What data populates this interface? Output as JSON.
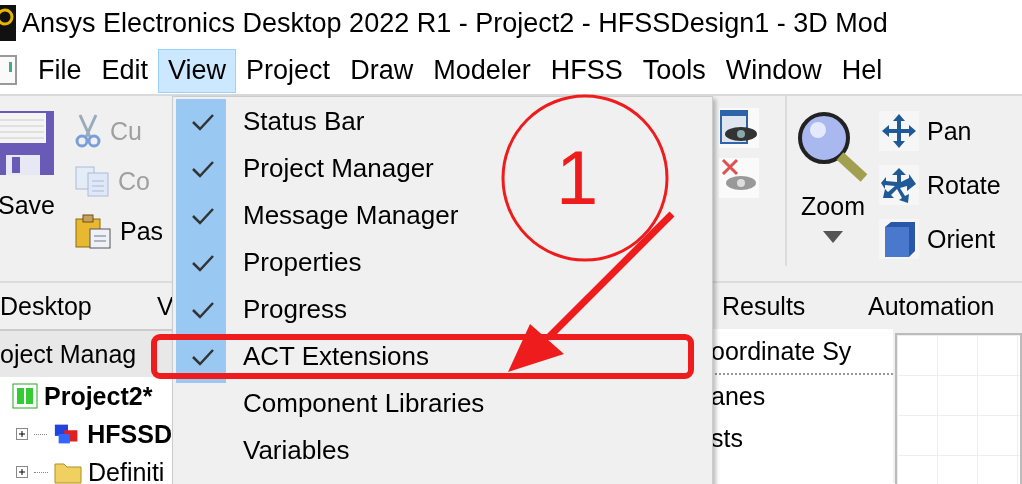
{
  "window": {
    "title": "Ansys Electronics Desktop 2022 R1 - Project2 - HFSSDesign1 - 3D Mod"
  },
  "menu_bar": [
    {
      "label": "File",
      "selected": false
    },
    {
      "label": "Edit",
      "selected": false
    },
    {
      "label": "View",
      "selected": true
    },
    {
      "label": "Project",
      "selected": false
    },
    {
      "label": "Draw",
      "selected": false
    },
    {
      "label": "Modeler",
      "selected": false
    },
    {
      "label": "HFSS",
      "selected": false
    },
    {
      "label": "Tools",
      "selected": false
    },
    {
      "label": "Window",
      "selected": false
    },
    {
      "label": "Hel",
      "selected": false
    }
  ],
  "ribbon": {
    "save": "Save",
    "clipboard": [
      {
        "kind": "cut",
        "label": "Cu",
        "disabled": true
      },
      {
        "kind": "copy",
        "label": "Co",
        "disabled": true
      },
      {
        "kind": "paste",
        "label": "Pas",
        "disabled": false
      }
    ],
    "zoom": "Zoom",
    "navigate": [
      {
        "kind": "pan",
        "label": "Pan"
      },
      {
        "kind": "rotate",
        "label": "Rotate"
      },
      {
        "kind": "orient",
        "label": "Orient"
      }
    ]
  },
  "ribbon_tabs": [
    "Desktop",
    "V",
    "Results",
    "Automation"
  ],
  "project_manager": {
    "title": "oject Manag",
    "tree": [
      {
        "label": "Project2*",
        "kind": "project",
        "children": [
          {
            "label": "HFSSD",
            "kind": "design",
            "expanded": false
          },
          {
            "label": "Definiti",
            "kind": "folder",
            "expanded": false
          }
        ]
      }
    ]
  },
  "coordinate_panel": {
    "title": "oordinate Sy",
    "items": [
      "anes",
      "sts"
    ]
  },
  "view_menu": [
    {
      "label": "Status Bar",
      "checked": true
    },
    {
      "label": "Project Manager",
      "checked": true
    },
    {
      "label": "Message Manager",
      "checked": true
    },
    {
      "label": "Properties",
      "checked": true
    },
    {
      "label": "Progress",
      "checked": true
    },
    {
      "label": "ACT Extensions",
      "checked": true
    },
    {
      "label": "Component Libraries",
      "checked": false
    },
    {
      "label": "Variables",
      "checked": false
    }
  ],
  "annotation": {
    "label": "1"
  }
}
